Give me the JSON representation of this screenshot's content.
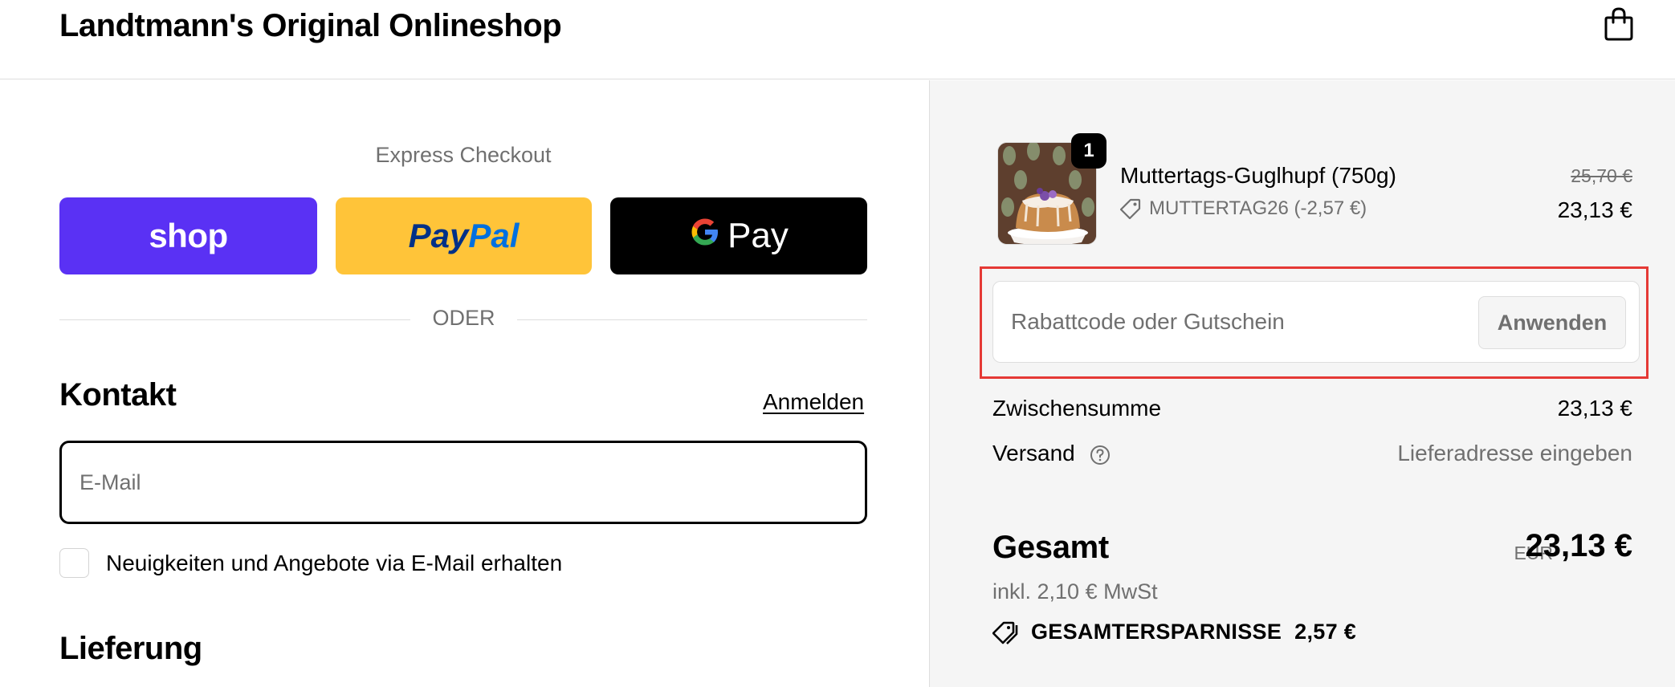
{
  "header": {
    "shop_title": "Landtmann's Original Onlineshop"
  },
  "express": {
    "label": "Express Checkout",
    "shop_label": "shop",
    "paypal_part1": "Pay",
    "paypal_part2": "Pal",
    "gpay_g": "G",
    "gpay_label": "Pay",
    "divider": "ODER"
  },
  "contact": {
    "heading": "Kontakt",
    "login_link": "Anmelden",
    "email_placeholder": "E-Mail",
    "email_value": "",
    "newsletter_label": "Neuigkeiten und Angebote via E-Mail erhalten",
    "newsletter_checked": false
  },
  "delivery": {
    "heading": "Lieferung"
  },
  "summary": {
    "product": {
      "quantity": "1",
      "name": "Muttertags-Guglhupf (750g)",
      "discount_code": "MUTTERTAG26 (-2,57 €)",
      "price_original": "25,70 €",
      "price_current": "23,13 €"
    },
    "discount_field": {
      "placeholder": "Rabattcode oder Gutschein",
      "apply_label": "Anwenden"
    },
    "subtotal_label": "Zwischensumme",
    "subtotal_value": "23,13 €",
    "shipping_label": "Versand",
    "shipping_value": "Lieferadresse eingeben",
    "total_label": "Gesamt",
    "currency": "EUR",
    "total_value": "23,13 €",
    "tax_line": "inkl. 2,10 € MwSt",
    "savings_label": "GESAMTERSPARNISSE",
    "savings_value": "2,57 €"
  },
  "colors": {
    "shop_pay": "#5a31f4",
    "paypal": "#ffc439",
    "gpay": "#000000",
    "highlight_box": "#e53935",
    "summary_bg": "#f5f5f5"
  },
  "icons": {
    "cart": "shopping-bag-icon",
    "discount": "tag-icon",
    "shipping_help": "question-circle-icon",
    "savings": "tags-icon"
  }
}
